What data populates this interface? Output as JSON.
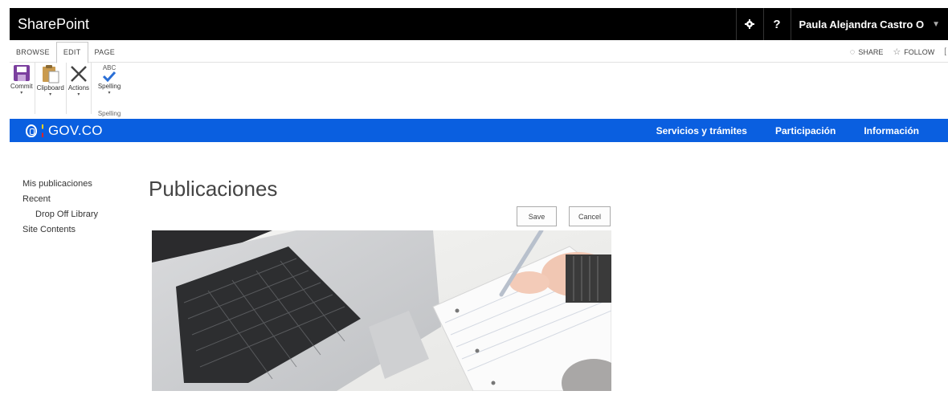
{
  "suitebar": {
    "title": "SharePoint",
    "settings_icon": "gear-icon",
    "help_label": "?",
    "user_name": "Paula Alejandra Castro O"
  },
  "ribbon": {
    "tabs": [
      "BROWSE",
      "EDIT",
      "PAGE"
    ],
    "active_tab": "EDIT",
    "share_label": "SHARE",
    "follow_label": "FOLLOW",
    "buttons": {
      "commit": "Commit",
      "clipboard": "Clipboard",
      "actions": "Actions",
      "spelling": "Spelling",
      "spelling_abc": "ABC"
    },
    "group_spelling": "Spelling"
  },
  "govbar": {
    "logo_text": "GOV.CO",
    "nav": [
      "Servicios y trámites",
      "Participación",
      "Información"
    ]
  },
  "leftnav": {
    "items": [
      "Mis publicaciones",
      "Recent",
      "Drop Off Library",
      "Site Contents"
    ]
  },
  "main": {
    "title": "Publicaciones",
    "save_label": "Save",
    "cancel_label": "Cancel"
  },
  "colors": {
    "suitebar_bg": "#000000",
    "gov_blue": "#0a5fe0"
  }
}
